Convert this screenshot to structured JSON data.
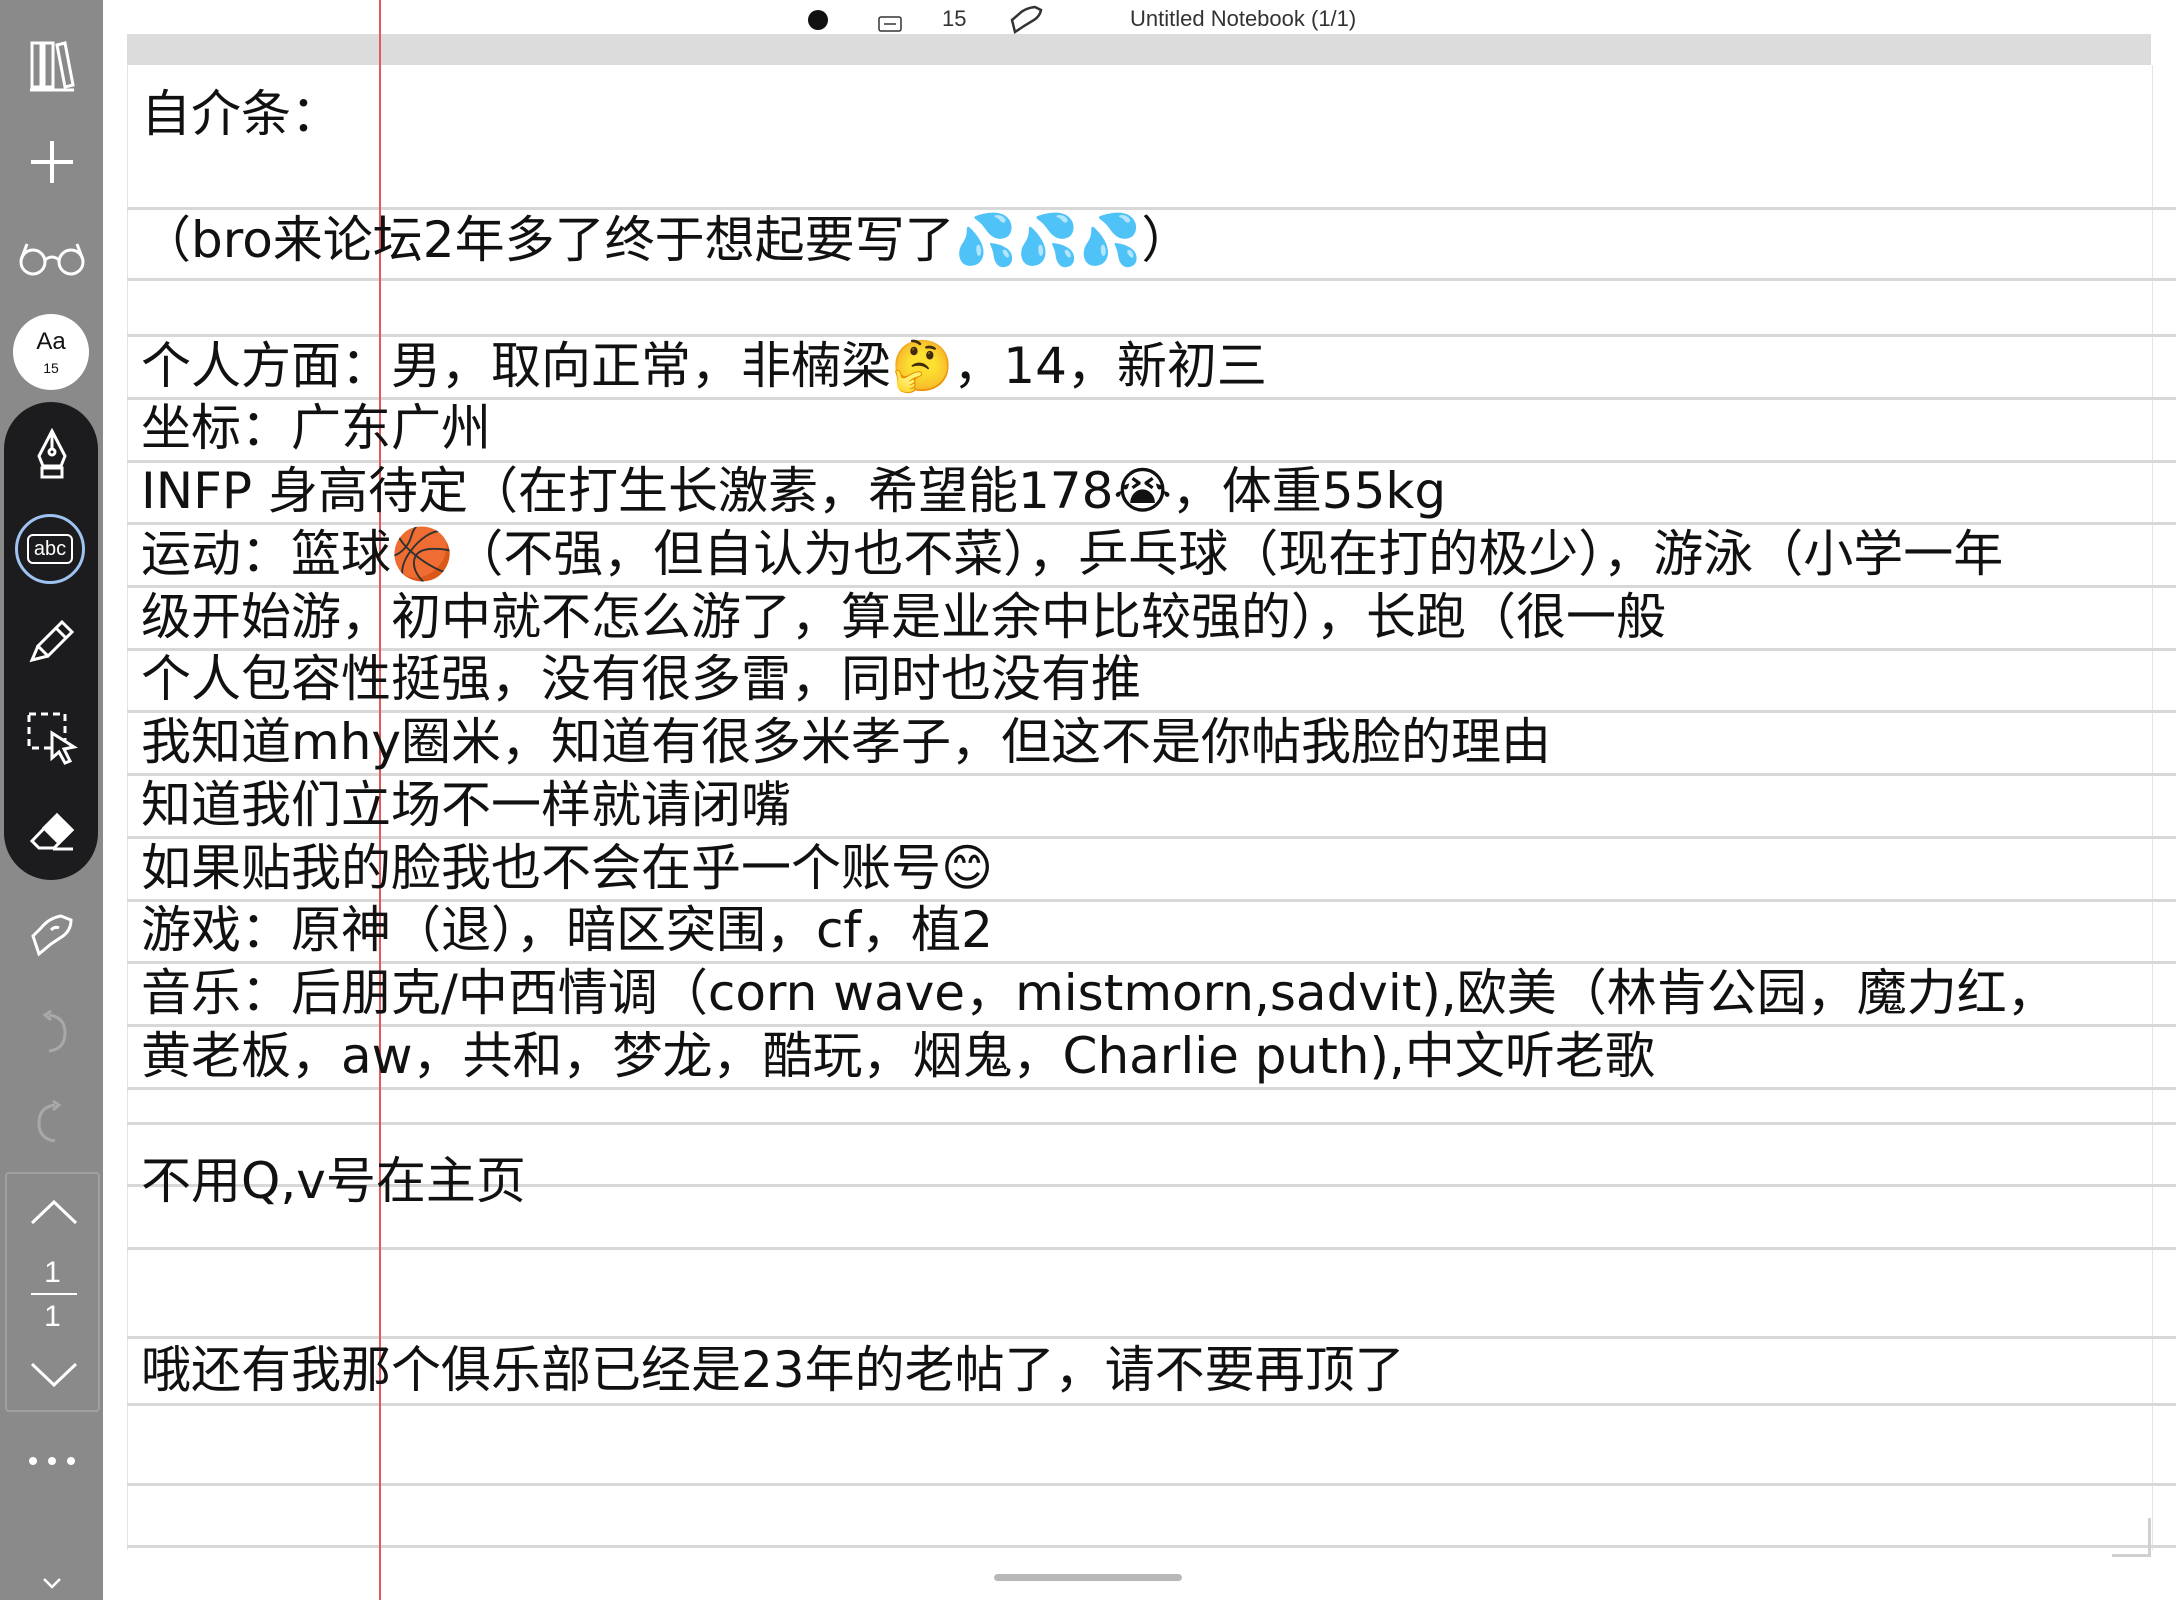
{
  "topbar": {
    "page_count": "15",
    "title": "Untitled Notebook (1/1)"
  },
  "sidebar": {
    "font_label": "Aa",
    "font_size": "15",
    "text_tool_label": "abc",
    "page_current": "1",
    "page_total": "1",
    "icons": [
      "library-icon",
      "add-icon",
      "reading-glasses-icon",
      "font-icon",
      "pen-icon",
      "text-icon",
      "highlighter-icon",
      "lasso-icon",
      "eraser-icon",
      "shapes-icon",
      "undo-icon",
      "redo-icon",
      "page-up-icon",
      "page-down-icon",
      "more-icon",
      "chevron-down-icon"
    ]
  },
  "note": {
    "lines": [
      "自介条：",
      "（bro来论坛2年多了终于想起要写了💦💦💦）",
      "个人方面：男，取向正常，非楠梁🤔，14，新初三",
      "坐标：广东广州",
      "INFP 身高待定（在打生长激素，希望能178😭，体重55kg",
      "运动：篮球🏀（不强，但自认为也不菜），乒乓球（现在打的极少），游泳（小学一年",
      "级开始游，初中就不怎么游了，算是业余中比较强的），长跑（很一般",
      "个人包容性挺强，没有很多雷，同时也没有推",
      "我知道mhy圈米，知道有很多米孝子，但这不是你帖我脸的理由",
      "知道我们立场不一样就请闭嘴",
      "如果贴我的脸我也不会在乎一个账号😊",
      "游戏：原神（退），暗区突围，cf，植2",
      "音乐：后朋克/中西情调（corn wave，mistmorn,sadvit),欧美（林肯公园，魔力红，",
      "黄老板，aw，共和，梦龙，酷玩，烟鬼，Charlie puth),中文听老歌",
      "不用Q,v号在主页",
      "哦还有我那个俱乐部已经是23年的老帖了，请不要再顶了"
    ]
  },
  "colors": {
    "sidebar": "#8a8a8a",
    "tool_group": "#1c1c1e",
    "margin_line": "#e05a5a",
    "rule": "#d8d8d8",
    "accent": "#9ec3f0"
  }
}
